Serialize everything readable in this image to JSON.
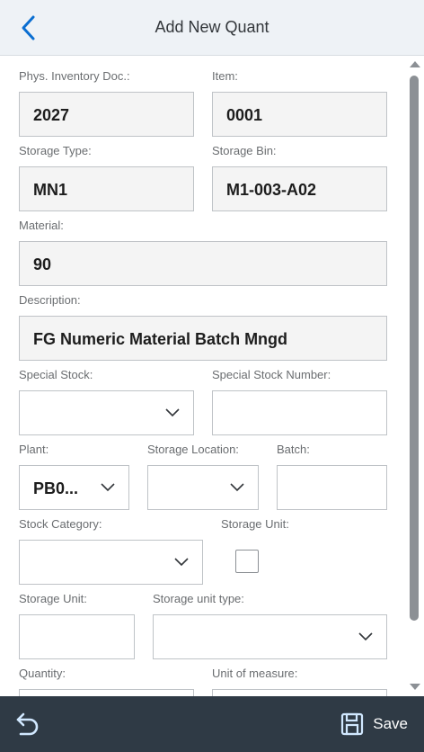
{
  "header": {
    "title": "Add New Quant"
  },
  "form": {
    "phys_doc": {
      "label": "Phys. Inventory Doc.:",
      "value": "2027"
    },
    "item": {
      "label": "Item:",
      "value": "0001"
    },
    "storage_type": {
      "label": "Storage Type:",
      "value": "MN1"
    },
    "storage_bin": {
      "label": "Storage Bin:",
      "value": "M1-003-A02"
    },
    "material": {
      "label": "Material:",
      "value": "90"
    },
    "description": {
      "label": "Description:",
      "value": "FG Numeric Material Batch Mngd"
    },
    "special_stock": {
      "label": "Special Stock:",
      "value": ""
    },
    "special_stock_number": {
      "label": "Special Stock Number:",
      "value": ""
    },
    "plant": {
      "label": "Plant:",
      "value": "PB0..."
    },
    "storage_location": {
      "label": "Storage Location:",
      "value": ""
    },
    "batch": {
      "label": "Batch:",
      "value": ""
    },
    "stock_category": {
      "label": "Stock Category:",
      "value": ""
    },
    "storage_unit_check": {
      "label": "Storage Unit:",
      "checked": false
    },
    "storage_unit": {
      "label": "Storage Unit:",
      "value": ""
    },
    "storage_unit_type": {
      "label": "Storage unit type:",
      "value": ""
    },
    "quantity": {
      "label": "Quantity:",
      "value": ""
    },
    "unit_of_measure": {
      "label": "Unit of measure:",
      "value": ""
    }
  },
  "footer": {
    "save_label": "Save"
  },
  "icons": {
    "back": "chevron-left-icon",
    "undo": "undo-icon",
    "save": "save-icon"
  },
  "colors": {
    "header_bg": "#eef2f6",
    "footer_bg": "#2f3a45",
    "accent": "#0a6ed1"
  }
}
